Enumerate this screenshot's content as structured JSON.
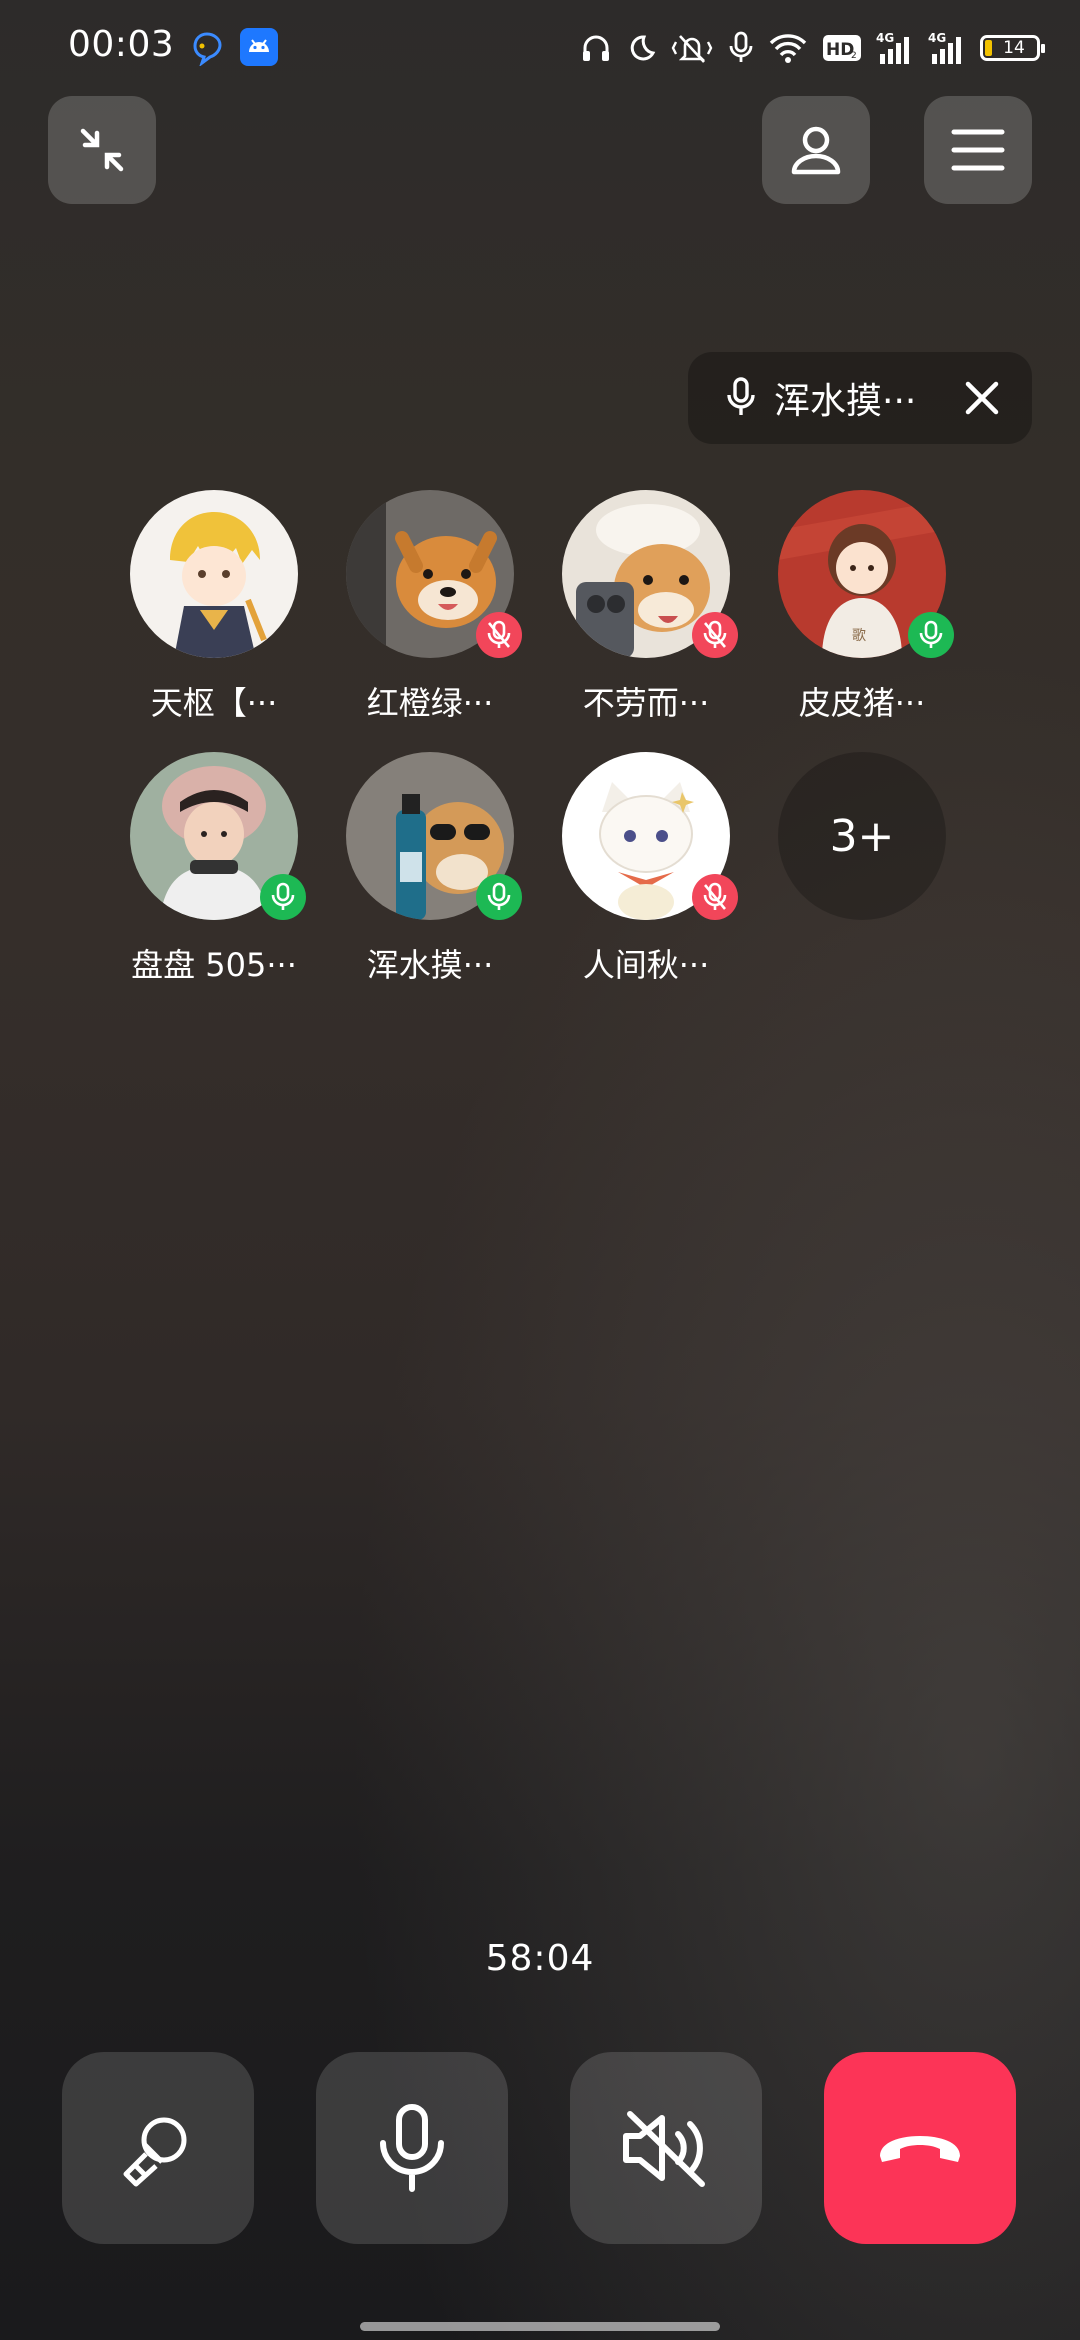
{
  "status_bar": {
    "time": "00:03",
    "network_4g_1": "4G",
    "network_4g_2": "4G",
    "hd_label": "HD",
    "battery_level": "14",
    "icons": [
      "app-notification-icon",
      "android-app-icon",
      "headphones-icon",
      "do-not-disturb-moon-icon",
      "vibrate-mute-icon",
      "microphone-in-use-icon",
      "wifi-icon",
      "hd-voice-icon",
      "signal-4g-icon",
      "signal-4g-icon",
      "battery-icon"
    ]
  },
  "top_bar": {
    "minimize_icon": "minimize-arrows-icon",
    "profile_icon": "person-icon",
    "menu_icon": "hamburger-menu-icon"
  },
  "speaker": {
    "name": "浑水摸···",
    "icon": "microphone-icon",
    "close_icon": "close-icon"
  },
  "participants": [
    {
      "name": "天枢【···",
      "mic": "none"
    },
    {
      "name": "红橙绿···",
      "mic": "muted"
    },
    {
      "name": "不劳而···",
      "mic": "muted"
    },
    {
      "name": "皮皮猪···",
      "mic": "on"
    },
    {
      "name": "盘盘 505···",
      "mic": "on"
    },
    {
      "name": "浑水摸···",
      "mic": "on"
    },
    {
      "name": "人间秋···",
      "mic": "muted"
    }
  ],
  "more_count": "3+",
  "call_timer": "58:04",
  "controls": [
    {
      "name": "speaker-toggle-icon"
    },
    {
      "name": "microphone-icon"
    },
    {
      "name": "speaker-muted-icon"
    },
    {
      "name": "hang-up-icon",
      "color": "#fc3457"
    }
  ],
  "colors": {
    "mic_on": "#1db954",
    "mic_muted": "#f2465a",
    "hang_up": "#fc3457"
  }
}
